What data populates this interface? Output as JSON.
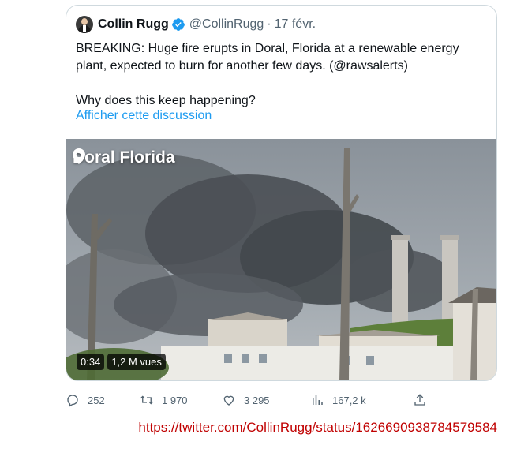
{
  "tweet": {
    "author_name": "Collin Rugg",
    "handle": "@CollinRugg",
    "separator": "·",
    "date": "17 févr.",
    "text_line1": "BREAKING: Huge fire erupts in Doral, Florida at a renewable energy plant, expected to burn for another few days. (@rawsalerts)",
    "text_line2": "Why does this keep happening?",
    "show_thread": "Afficher cette discussion"
  },
  "media": {
    "location_label": "Doral Florida",
    "duration": "0:34",
    "views_badge": "1,2 M vues"
  },
  "actions": {
    "replies": "252",
    "retweets": "1 970",
    "likes": "3 295",
    "views": "167,2 k"
  },
  "source_url": "https://twitter.com/CollinRugg/status/1626690938784579584",
  "colors": {
    "link_blue": "#1d9bf0",
    "url_red": "#c00000",
    "muted": "#536471",
    "border": "#cfd9de"
  }
}
